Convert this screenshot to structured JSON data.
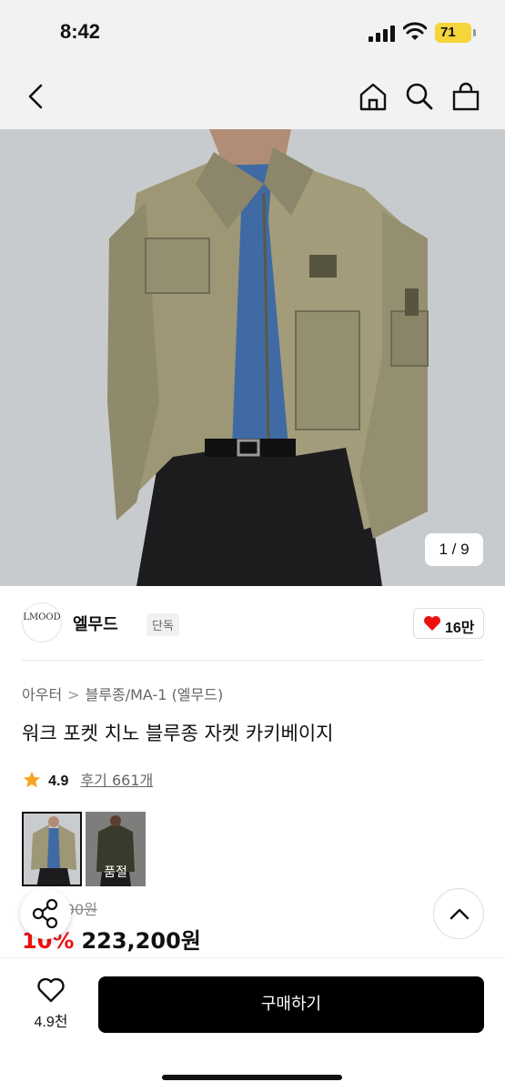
{
  "status": {
    "time": "8:42",
    "battery": "71"
  },
  "nav": {
    "back_icon": "chevron-left-icon",
    "home_icon": "home-icon",
    "search_icon": "search-icon",
    "bag_icon": "shopping-bag-icon"
  },
  "gallery": {
    "counter": "1 / 9"
  },
  "brand": {
    "logo_text": "LMOOD",
    "name": "엘무드",
    "tag": "단독",
    "likes": "16만"
  },
  "breadcrumbs": [
    "아우터",
    "블루종/MA-1 (엘무드)"
  ],
  "product": {
    "title": "워크 포켓 치노 블루종 자켓 카키베이지"
  },
  "rating": {
    "score": "4.9",
    "reviews": "후기 661개"
  },
  "variants": [
    {
      "selected": true,
      "label": ""
    },
    {
      "selected": false,
      "label": "품절"
    }
  ],
  "price": {
    "original": "248,000원",
    "discount": "10%",
    "final": "223,200원"
  },
  "bottom_bar": {
    "wish_count": "4.9천",
    "buy_label": "구매하기"
  },
  "colors": {
    "accent_red": "#e11111",
    "buy_bg": "#000000",
    "star": "#f5a623"
  }
}
